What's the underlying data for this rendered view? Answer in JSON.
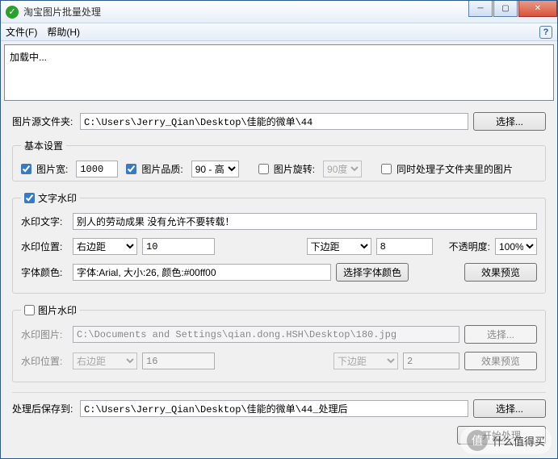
{
  "window": {
    "title": "淘宝图片批量处理"
  },
  "menu": {
    "file": "文件(F)",
    "help": "帮助(H)",
    "help_icon": "?"
  },
  "loading": "加载中...",
  "source": {
    "label": "图片源文件夹:",
    "path": "C:\\Users\\Jerry_Qian\\Desktop\\佳能的微单\\44",
    "browse": "选择..."
  },
  "basic": {
    "legend": "基本设置",
    "width_label": "图片宽:",
    "width_value": "1000",
    "quality_label": "图片品质:",
    "quality_value": "90 - 高",
    "rotate_label": "图片旋转:",
    "rotate_value": "90度",
    "subfolder_label": "同时处理子文件夹里的图片"
  },
  "text_wm": {
    "legend": "文字水印",
    "text_label": "水印文字:",
    "text_value": "别人的劳动成果 没有允许不要转载！",
    "pos_label": "水印位置:",
    "hpos_value": "右边距",
    "hoff_value": "10",
    "vpos_value": "下边距",
    "voff_value": "8",
    "opacity_label": "不透明度:",
    "opacity_value": "100%",
    "font_label": "字体颜色:",
    "font_desc": "字体:Arial, 大小:26, 颜色:#00ff00",
    "font_btn": "选择字体颜色",
    "preview_btn": "效果预览"
  },
  "img_wm": {
    "legend": "图片水印",
    "img_label": "水印图片:",
    "img_path": "C:\\Documents and Settings\\qian.dong.HSH\\Desktop\\180.jpg",
    "browse": "选择...",
    "pos_label": "水印位置:",
    "hpos_value": "右边距",
    "hoff_value": "16",
    "vpos_value": "下边距",
    "voff_value": "2",
    "preview_btn": "效果预览"
  },
  "output": {
    "label": "处理后保存到:",
    "path": "C:\\Users\\Jerry_Qian\\Desktop\\佳能的微单\\44_处理后",
    "browse": "选择..."
  },
  "start_btn": "开始处理",
  "overlay": "什么值得买"
}
